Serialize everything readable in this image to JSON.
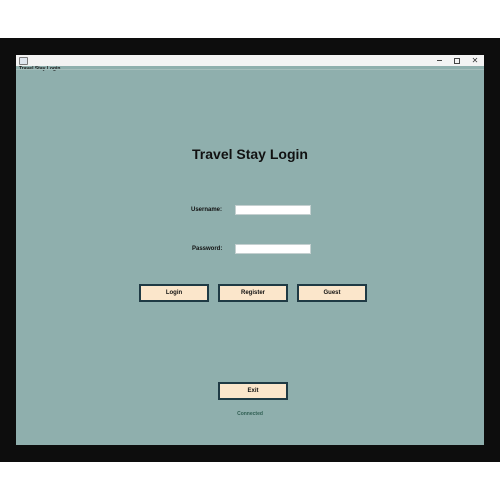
{
  "window": {
    "title": "Travel Stay Login",
    "controls": {
      "minimize": "–",
      "maximize": "□",
      "close": "✕"
    }
  },
  "form": {
    "heading": "Travel Stay Login",
    "username_label": "Username:",
    "username_value": "",
    "password_label": "Password:",
    "password_value": ""
  },
  "buttons": {
    "login": "Login",
    "register": "Register",
    "guest": "Guest",
    "exit": "Exit"
  },
  "status": "Connected",
  "colors": {
    "background": "#8fafad",
    "button_fill": "#fbe6cb",
    "button_border": "#1f3a44",
    "status_text": "#2f5e52"
  }
}
